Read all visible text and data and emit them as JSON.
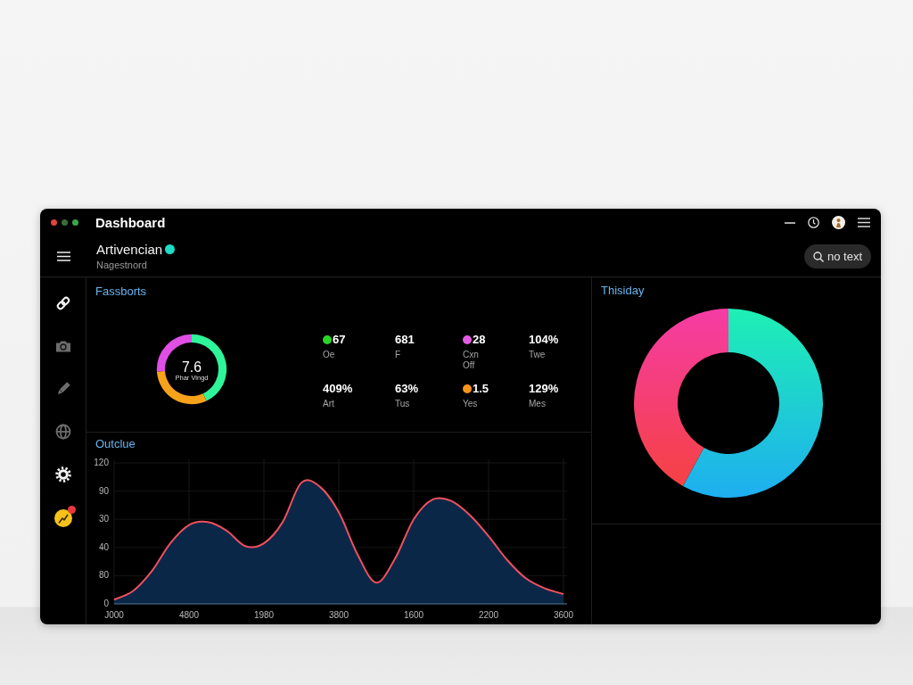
{
  "window": {
    "title": "Dashboard"
  },
  "header": {
    "name": "Artivencian",
    "online": true,
    "subtitle": "Nagestnord",
    "search": {
      "label": "no text"
    }
  },
  "sidebar": {
    "items": [
      {
        "active": true,
        "badge": false
      },
      {
        "active": false,
        "badge": false
      },
      {
        "active": false,
        "badge": false
      },
      {
        "active": false,
        "badge": false
      },
      {
        "active": true,
        "badge": false
      },
      {
        "active": true,
        "badge": true
      }
    ]
  },
  "fassborts": {
    "title": "Fassborts",
    "donut": {
      "value": "7.6",
      "caption": "Phar Vingd",
      "chart_data": {
        "type": "donut",
        "values": [
          43,
          31,
          26
        ],
        "colors": [
          "#2ef59a",
          "#f7a21b",
          "#e04ee6"
        ]
      }
    },
    "stats": [
      {
        "value": "67",
        "label": "Oe",
        "color": "#27d627"
      },
      {
        "value": "681",
        "label": "F"
      },
      {
        "value": "28",
        "label": "Cxn Off",
        "color": "#e35be3"
      },
      {
        "value": "104%",
        "label": "Twe"
      },
      {
        "value": "409%",
        "label": "Art"
      },
      {
        "value": "63%",
        "label": "Tus"
      },
      {
        "value": "1.5",
        "label": "Yes",
        "color": "#f7941d"
      },
      {
        "value": "129%",
        "label": "Mes"
      }
    ]
  },
  "outclue": {
    "title": "Outclue",
    "y_labels": [
      "120",
      "90",
      "30",
      "40",
      "80",
      "0"
    ],
    "x_labels": [
      "J000",
      "4800",
      "1980",
      "3800",
      "1600",
      "2200",
      "3600"
    ]
  },
  "thisiday": {
    "title": "Thisiday",
    "chart_data": {
      "type": "donut",
      "values": [
        58,
        42
      ],
      "colors": [
        "#1ef0b4",
        "#f53ca5"
      ]
    }
  }
}
